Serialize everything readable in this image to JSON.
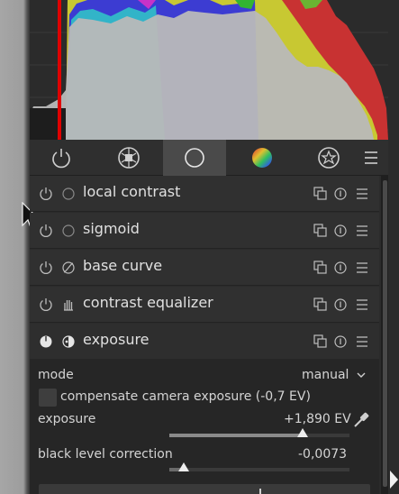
{
  "tabs": [
    {
      "icon": "power-icon",
      "active": false
    },
    {
      "icon": "shutter-icon",
      "active": false
    },
    {
      "icon": "circle-icon",
      "active": true
    },
    {
      "icon": "color-wheel-icon",
      "active": false
    },
    {
      "icon": "effects-icon",
      "active": false
    },
    {
      "icon": "menu-icon",
      "active": false
    }
  ],
  "modules": [
    {
      "label": "local contrast",
      "icon": "circle-icon"
    },
    {
      "label": "sigmoid",
      "icon": "circle-icon"
    },
    {
      "label": "base curve",
      "icon": "curve-icon"
    },
    {
      "label": "contrast equalizer",
      "icon": "hand-icon"
    },
    {
      "label": "exposure",
      "icon": "exposure-icon"
    }
  ],
  "exposure_panel": {
    "mode_label": "mode",
    "mode_value": "manual",
    "compensate_label": "compensate camera exposure (-0,7 EV)",
    "compensate_checked": false,
    "exposure_label": "exposure",
    "exposure_value": "+1,890 EV",
    "exposure_slider_position": 0.74,
    "black_label": "black level correction",
    "black_value": "-0,0073",
    "black_slider_position": 0.08
  },
  "colors": {
    "accent_red": "#e00000",
    "histogram_gray": "#b9b9b9",
    "histogram_red": "#c83232",
    "histogram_yellow": "#c8c832",
    "histogram_blue": "#3c3cd2",
    "histogram_cyan": "#32b4c8"
  }
}
